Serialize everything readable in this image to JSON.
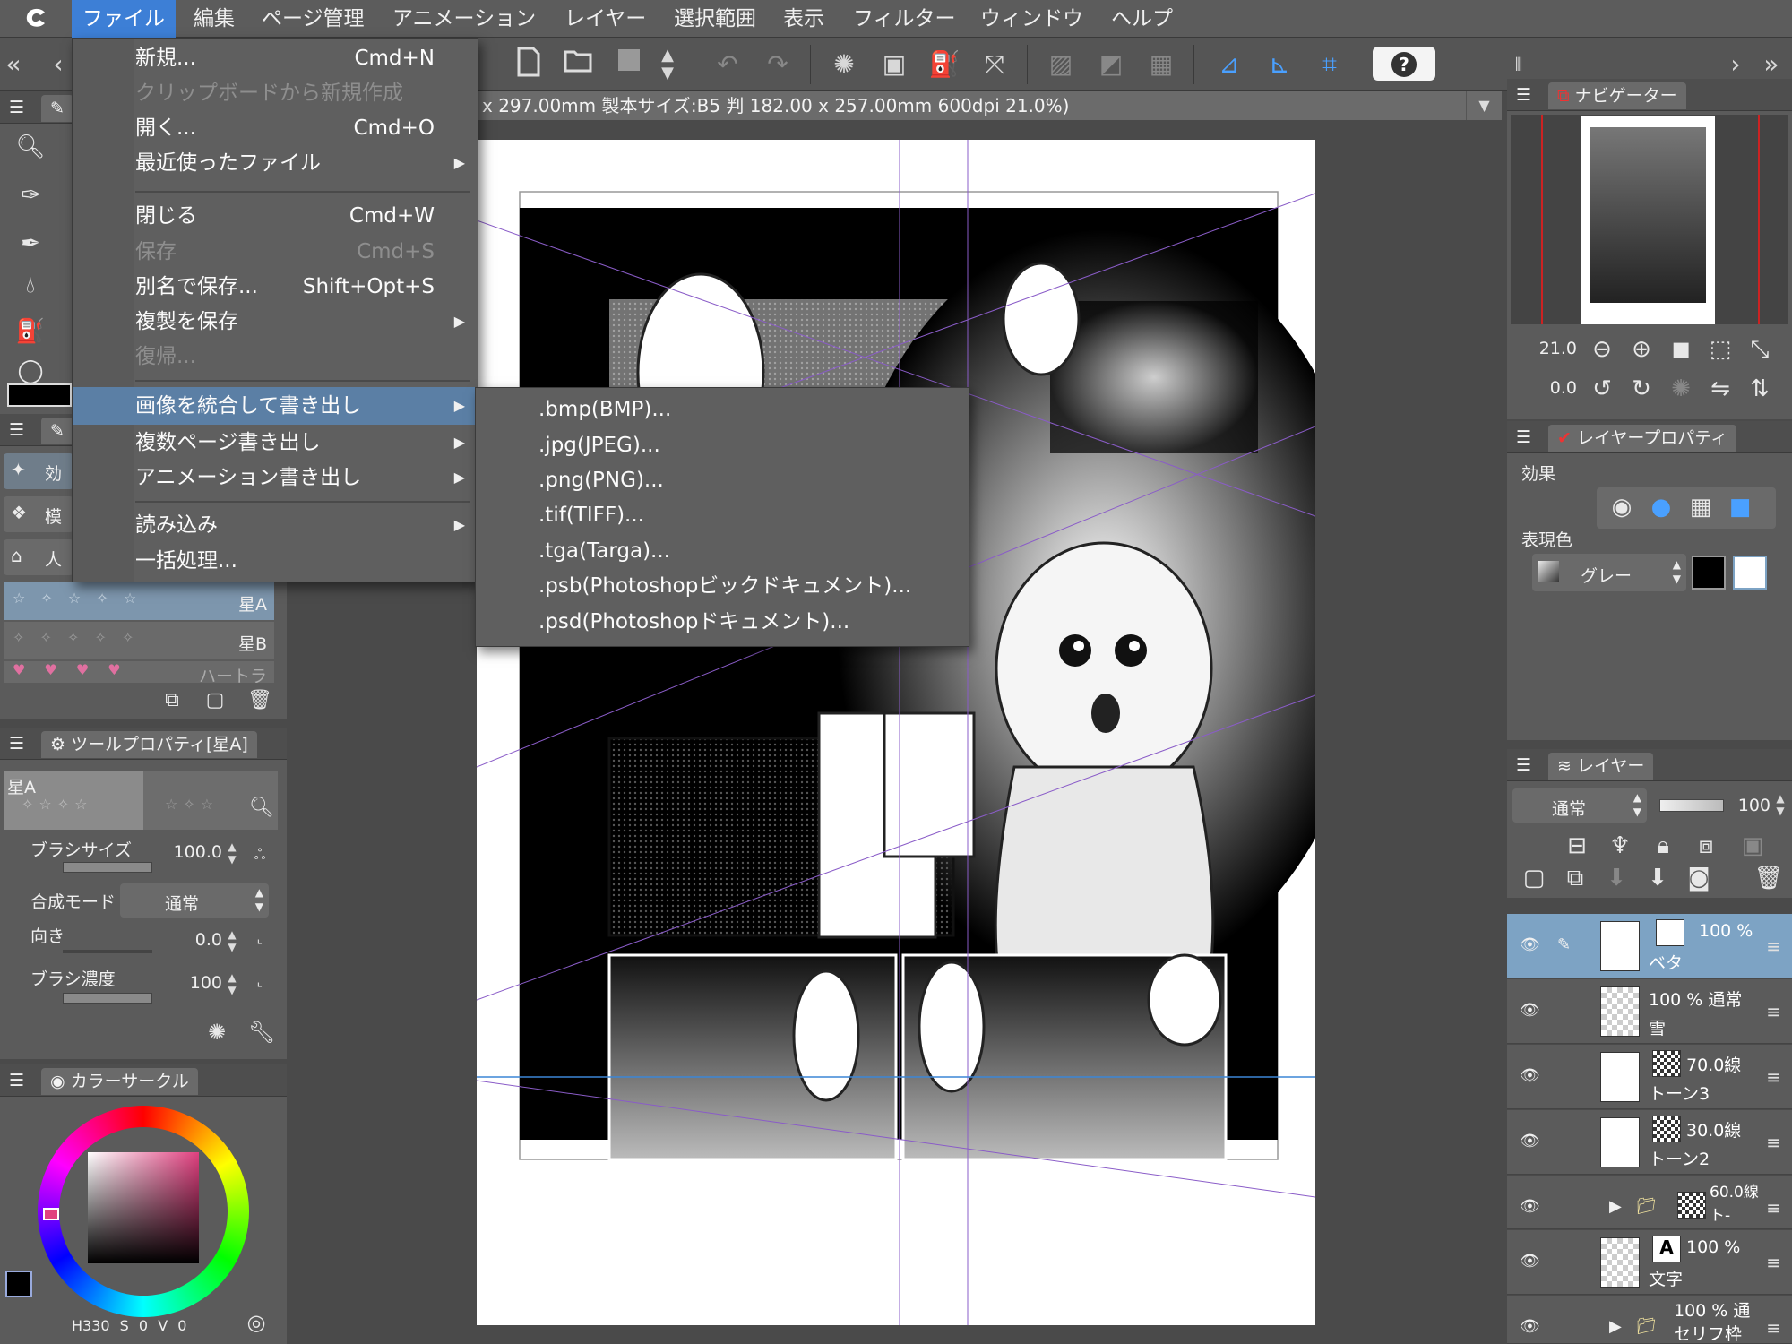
{
  "menubar": {
    "items": [
      "ファイル",
      "編集",
      "ページ管理",
      "アニメーション",
      "レイヤー",
      "選択範囲",
      "表示",
      "フィルター",
      "ウィンドウ",
      "ヘルプ"
    ]
  },
  "document": {
    "title": "x 297.00mm 製本サイズ:B5 判 182.00 x 257.00mm 600dpi 21.0%)"
  },
  "file_menu": {
    "items": [
      {
        "label": "新規...",
        "shortcut": "Cmd+N",
        "disabled": false,
        "submenu": false
      },
      {
        "label": "クリップボードから新規作成",
        "shortcut": "",
        "disabled": true,
        "submenu": false
      },
      {
        "label": "開く...",
        "shortcut": "Cmd+O",
        "disabled": false,
        "submenu": false
      },
      {
        "label": "最近使ったファイル",
        "shortcut": "",
        "disabled": false,
        "submenu": true
      },
      {
        "label": "閉じる",
        "shortcut": "Cmd+W",
        "disabled": false,
        "submenu": false
      },
      {
        "label": "保存",
        "shortcut": "Cmd+S",
        "disabled": true,
        "submenu": false
      },
      {
        "label": "別名で保存...",
        "shortcut": "Shift+Opt+S",
        "disabled": false,
        "submenu": false
      },
      {
        "label": "複製を保存",
        "shortcut": "",
        "disabled": false,
        "submenu": true
      },
      {
        "label": "復帰...",
        "shortcut": "",
        "disabled": true,
        "submenu": false
      },
      {
        "label": "画像を統合して書き出し",
        "shortcut": "",
        "disabled": false,
        "submenu": true,
        "active": true
      },
      {
        "label": "複数ページ書き出し",
        "shortcut": "",
        "disabled": false,
        "submenu": true
      },
      {
        "label": "アニメーション書き出し",
        "shortcut": "",
        "disabled": false,
        "submenu": true
      },
      {
        "label": "読み込み",
        "shortcut": "",
        "disabled": false,
        "submenu": true
      },
      {
        "label": "一括処理...",
        "shortcut": "",
        "disabled": false,
        "submenu": false
      }
    ]
  },
  "export_submenu": {
    "items": [
      ".bmp(BMP)...",
      ".jpg(JPEG)...",
      ".png(PNG)...",
      ".tif(TIFF)...",
      ".tga(Targa)...",
      ".psb(Photoshopビックドキュメント)...",
      ".psd(Photoshopドキュメント)..."
    ]
  },
  "left": {
    "subtool_items": [
      {
        "short": "効",
        "label": "効果"
      },
      {
        "short": "模",
        "label": "模様"
      },
      {
        "short": "人",
        "label": "人工"
      }
    ],
    "brush_list": [
      "星A",
      "星B",
      "ハートラ"
    ],
    "tool_property": {
      "title": "ツールプロパティ[星A]",
      "preview_label": "星A",
      "brush_size_label": "ブラシサイズ",
      "brush_size_value": "100.0",
      "blend_label": "合成モード",
      "blend_value": "通常",
      "direction_label": "向き",
      "direction_value": "0.0",
      "density_label": "ブラシ濃度",
      "density_value": "100"
    },
    "color_circle": {
      "title": "カラーサークル",
      "h_label": "H",
      "h_value": "330",
      "s_label": "S",
      "s_value": "0",
      "v_label": "V",
      "v_value": "0",
      "main_color": "#000000",
      "sub_color": "#ffffff"
    }
  },
  "right": {
    "navigator": {
      "title": "ナビゲーター",
      "zoom": "21.0",
      "rotation": "0.0"
    },
    "layer_property": {
      "title": "レイヤープロパティ",
      "effect_label": "効果",
      "expression_label": "表現色",
      "expression_value": "グレー"
    },
    "layers_panel": {
      "title": "レイヤー",
      "blend_mode": "通常",
      "opacity": "100",
      "layers": [
        {
          "top": "100 %",
          "name": "ベタ",
          "selected": true
        },
        {
          "top": "100 % 通常",
          "name": "雪",
          "selected": false
        },
        {
          "top": "70.0線",
          "name": "トーン3",
          "selected": false
        },
        {
          "top": "30.0線",
          "name": "トーン2",
          "selected": false
        },
        {
          "top": "60.0線",
          "name": "ト-",
          "selected": false
        },
        {
          "top": "100 %",
          "name": "文字",
          "selected": false
        },
        {
          "top": "100 % 通",
          "name": "セリフ枠",
          "selected": false
        }
      ]
    }
  },
  "colors": {
    "accent": "#3d7fd6",
    "menu_bg": "#5f5f5f",
    "menu_active": "#5b7fa5",
    "panel_bg": "#5b5b5b",
    "selected_layer": "#7da3c4"
  }
}
